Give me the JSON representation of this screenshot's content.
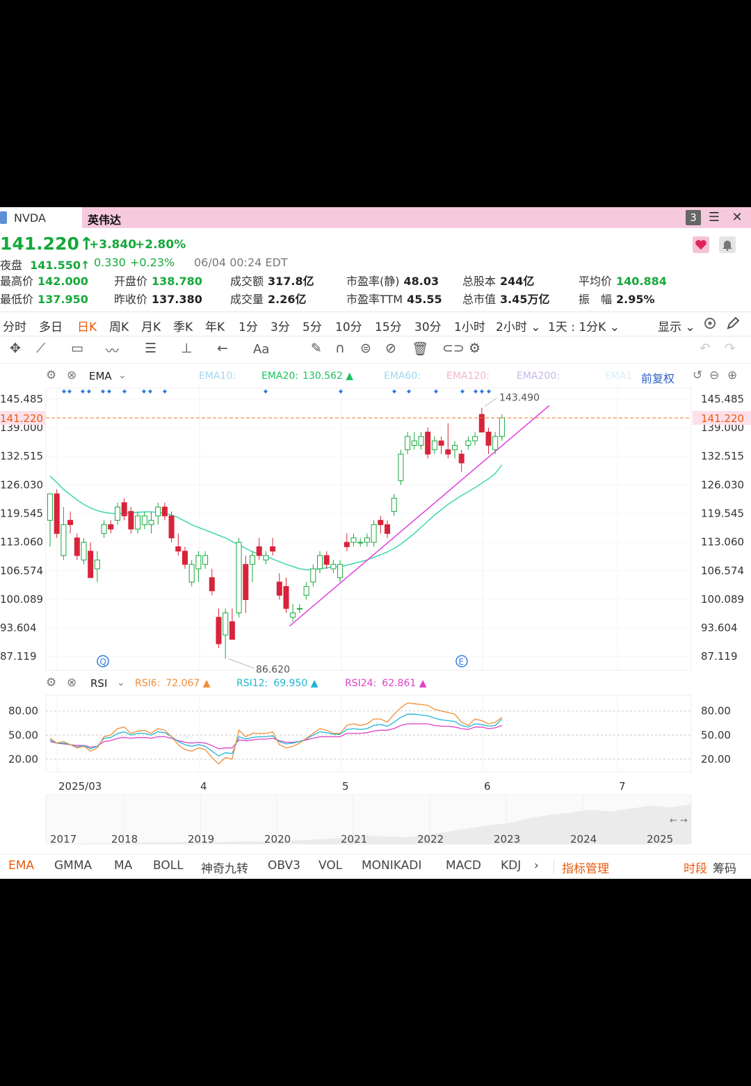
{
  "window": {
    "symbol": "NVDA",
    "name": "英伟达",
    "btn_layout": "3",
    "btn_menu": "☰",
    "btn_close": "✕"
  },
  "quote": {
    "price": "141.220",
    "arrow": "↑",
    "change": "+3.840",
    "change_pct": "+2.80%",
    "night_label": "夜盘",
    "night_price": "141.550↑",
    "night_change": "0.330",
    "night_pct": "+0.23%",
    "night_time": "06/04 00:24 EDT",
    "fields": [
      {
        "label": "最高价",
        "value": "142.000",
        "style": "g"
      },
      {
        "label": "开盘价",
        "value": "138.780",
        "style": "g"
      },
      {
        "label": "成交额",
        "value": "317.8亿",
        "style": "k"
      },
      {
        "label": "市盈率(静)",
        "value": "48.03",
        "style": "k"
      },
      {
        "label": "总股本",
        "value": "244亿",
        "style": "k"
      },
      {
        "label": "平均价",
        "value": "140.884",
        "style": "g"
      },
      {
        "label": "最低价",
        "value": "137.950",
        "style": "g"
      },
      {
        "label": "昨收价",
        "value": "137.380",
        "style": "k"
      },
      {
        "label": "成交量",
        "value": "2.26亿",
        "style": "k"
      },
      {
        "label": "市盈率TTM",
        "value": "45.55",
        "style": "k"
      },
      {
        "label": "总市值",
        "value": "3.45万亿",
        "style": "k"
      },
      {
        "label": "振　幅",
        "value": "2.95%",
        "style": "k"
      }
    ]
  },
  "periods": [
    "分时",
    "多日",
    "日K",
    "周K",
    "月K",
    "季K",
    "年K",
    "1分",
    "3分",
    "5分",
    "10分",
    "15分",
    "30分",
    "1小时",
    "2小时 ⌄",
    "1天 : 1分K ⌄",
    "显示 ⌄"
  ],
  "active_period": "日K",
  "toolbar_icons": [
    "move-icon",
    "line-tool-icon",
    "rect-tool-icon",
    "wave-tool-icon",
    "fib-tool-icon",
    "level-tool-icon",
    "arrow-tool-icon",
    "text-tool-icon",
    "comment-tool-icon",
    "pen-icon",
    "magnet-icon",
    "eye-icon",
    "hide-icon",
    "trash-icon",
    "link-icon",
    "settings-icon"
  ],
  "toolbar_text_label": "Aa",
  "main_indicator": {
    "name": "EMA",
    "items": [
      {
        "label": "EMA10:",
        "value": "",
        "color": "#9fd6ef"
      },
      {
        "label": "EMA20:",
        "value": "130.562 ▲",
        "color": "#19c25a"
      },
      {
        "label": "EMA60:",
        "value": "",
        "color": "#9fd6ef"
      },
      {
        "label": "EMA120:",
        "value": "",
        "color": "#f5b3c9"
      },
      {
        "label": "EMA200:",
        "value": "",
        "color": "#c9b6e8"
      },
      {
        "label": "EMA1",
        "value": "",
        "color": "#d6eef8"
      }
    ],
    "adjust": "前复权"
  },
  "sub_indicator": {
    "name": "RSI",
    "items": [
      {
        "label": "RSI6:",
        "value": "72.067 ▲",
        "color": "#f08c35"
      },
      {
        "label": "RSI12:",
        "value": "69.950 ▲",
        "color": "#1fb6d6"
      },
      {
        "label": "RSI24:",
        "value": "62.861 ▲",
        "color": "#e040c8"
      }
    ]
  },
  "y_ticks": [
    "145.485",
    "139.000",
    "132.515",
    "126.030",
    "119.545",
    "113.060",
    "106.574",
    "100.089",
    "93.604",
    "87.119"
  ],
  "current_price_tag": "141.220",
  "rsi_ticks": [
    "80.00",
    "50.00",
    "20.00"
  ],
  "high_label": "143.490",
  "low_label": "86.620",
  "x_labels": [
    "2025/03",
    "4",
    "5",
    "6",
    "7"
  ],
  "overview_years": [
    "2017",
    "2018",
    "2019",
    "2020",
    "2021",
    "2022",
    "2023",
    "2024",
    "2025"
  ],
  "marker_q": "Q",
  "marker_e": "E",
  "bottom_tabs": [
    "EMA",
    "GMMA",
    "MA",
    "BOLL",
    "神奇九转",
    "OBV3",
    "VOL",
    "MONIKADI",
    "MACD",
    "KDJ",
    "›",
    "指标管理"
  ],
  "bottom_right": [
    "时段",
    "筹码"
  ],
  "colors": {
    "up": "#15a83a",
    "down": "#d8233a",
    "accent": "#e8590c",
    "ema20": "#3dd6b0",
    "trend": "#e040e0"
  },
  "chart_data": {
    "type": "candlestick",
    "symbol": "NVDA",
    "ylim": [
      84,
      148
    ],
    "candles": [
      {
        "o": 118,
        "h": 124,
        "l": 112,
        "c": 124
      },
      {
        "o": 124,
        "h": 125,
        "l": 114,
        "c": 115
      },
      {
        "o": 110,
        "h": 121,
        "l": 109,
        "c": 117
      },
      {
        "o": 118,
        "h": 120,
        "l": 115,
        "c": 117
      },
      {
        "o": 114,
        "h": 115,
        "l": 109,
        "c": 110
      },
      {
        "o": 109,
        "h": 114,
        "l": 108,
        "c": 113
      },
      {
        "o": 111,
        "h": 113,
        "l": 105,
        "c": 105
      },
      {
        "o": 107,
        "h": 111,
        "l": 104,
        "c": 109
      },
      {
        "o": 115,
        "h": 118,
        "l": 114,
        "c": 117
      },
      {
        "o": 117,
        "h": 118,
        "l": 115,
        "c": 116
      },
      {
        "o": 118,
        "h": 122,
        "l": 117,
        "c": 121
      },
      {
        "o": 122,
        "h": 123,
        "l": 118,
        "c": 119
      },
      {
        "o": 120,
        "h": 121,
        "l": 115,
        "c": 116
      },
      {
        "o": 116,
        "h": 120,
        "l": 115,
        "c": 119
      },
      {
        "o": 117,
        "h": 120,
        "l": 116,
        "c": 119
      },
      {
        "o": 117,
        "h": 120,
        "l": 115,
        "c": 118
      },
      {
        "o": 119,
        "h": 122,
        "l": 117,
        "c": 121
      },
      {
        "o": 121,
        "h": 122,
        "l": 118,
        "c": 119
      },
      {
        "o": 119,
        "h": 120,
        "l": 113,
        "c": 114
      },
      {
        "o": 112,
        "h": 115,
        "l": 110,
        "c": 111
      },
      {
        "o": 111,
        "h": 112,
        "l": 107,
        "c": 108
      },
      {
        "o": 104,
        "h": 109,
        "l": 103,
        "c": 108
      },
      {
        "o": 107,
        "h": 111,
        "l": 104,
        "c": 110
      },
      {
        "o": 108,
        "h": 111,
        "l": 107,
        "c": 110
      },
      {
        "o": 105,
        "h": 107,
        "l": 101,
        "c": 102
      },
      {
        "o": 96,
        "h": 98,
        "l": 89,
        "c": 90
      },
      {
        "o": 92,
        "h": 98,
        "l": 86.62,
        "c": 97
      },
      {
        "o": 95,
        "h": 98,
        "l": 91,
        "c": 91
      },
      {
        "o": 97,
        "h": 114,
        "l": 96,
        "c": 113
      },
      {
        "o": 108,
        "h": 110,
        "l": 97,
        "c": 100
      },
      {
        "o": 108,
        "h": 111,
        "l": 104,
        "c": 110
      },
      {
        "o": 112,
        "h": 114,
        "l": 109,
        "c": 110
      },
      {
        "o": 109,
        "h": 111,
        "l": 108,
        "c": 110
      },
      {
        "o": 112,
        "h": 114,
        "l": 110,
        "c": 111
      },
      {
        "o": 104,
        "h": 106,
        "l": 100,
        "c": 101
      },
      {
        "o": 103,
        "h": 105,
        "l": 97,
        "c": 98
      },
      {
        "o": 96,
        "h": 99,
        "l": 95,
        "c": 97
      },
      {
        "o": 98,
        "h": 99,
        "l": 97,
        "c": 98
      },
      {
        "o": 101,
        "h": 104,
        "l": 100,
        "c": 103
      },
      {
        "o": 104,
        "h": 108,
        "l": 103,
        "c": 107
      },
      {
        "o": 107,
        "h": 111,
        "l": 106,
        "c": 110
      },
      {
        "o": 110,
        "h": 111,
        "l": 107,
        "c": 108
      },
      {
        "o": 107,
        "h": 109,
        "l": 106,
        "c": 108
      },
      {
        "o": 105,
        "h": 109,
        "l": 104,
        "c": 108
      },
      {
        "o": 113,
        "h": 115,
        "l": 111,
        "c": 112
      },
      {
        "o": 113,
        "h": 115,
        "l": 112,
        "c": 114
      },
      {
        "o": 113,
        "h": 114,
        "l": 112,
        "c": 113
      },
      {
        "o": 113,
        "h": 115,
        "l": 112,
        "c": 114
      },
      {
        "o": 113,
        "h": 118,
        "l": 112,
        "c": 117
      },
      {
        "o": 118,
        "h": 119,
        "l": 115,
        "c": 117
      },
      {
        "o": 117,
        "h": 118,
        "l": 114,
        "c": 115
      },
      {
        "o": 120,
        "h": 124,
        "l": 119,
        "c": 123
      },
      {
        "o": 127,
        "h": 134,
        "l": 126,
        "c": 133
      },
      {
        "o": 134,
        "h": 138,
        "l": 133,
        "c": 137
      },
      {
        "o": 135,
        "h": 138,
        "l": 134,
        "c": 136
      },
      {
        "o": 135,
        "h": 138,
        "l": 134,
        "c": 137
      },
      {
        "o": 138,
        "h": 139,
        "l": 132,
        "c": 133
      },
      {
        "o": 134,
        "h": 137,
        "l": 133,
        "c": 136
      },
      {
        "o": 136,
        "h": 137,
        "l": 133,
        "c": 135
      },
      {
        "o": 134,
        "h": 140,
        "l": 132,
        "c": 133
      },
      {
        "o": 134,
        "h": 136,
        "l": 132,
        "c": 135
      },
      {
        "o": 133,
        "h": 134,
        "l": 129,
        "c": 131
      },
      {
        "o": 135,
        "h": 137,
        "l": 134,
        "c": 136
      },
      {
        "o": 136,
        "h": 138,
        "l": 135,
        "c": 137
      },
      {
        "o": 142,
        "h": 143.49,
        "l": 138,
        "c": 138
      },
      {
        "o": 138,
        "h": 139,
        "l": 133,
        "c": 135
      },
      {
        "o": 134,
        "h": 138,
        "l": 133,
        "c": 137
      },
      {
        "o": 137,
        "h": 142,
        "l": 136,
        "c": 141.22
      }
    ],
    "ema20": [
      128,
      126.6,
      125,
      123.8,
      122.6,
      121.6,
      120.8,
      120.2,
      119.8,
      119.6,
      119.5,
      119.6,
      119.7,
      119.8,
      119.9,
      119.9,
      119.8,
      119.6,
      119.2,
      118.6,
      117.8,
      117,
      116.4,
      115.8,
      115.2,
      114.6,
      114,
      113.2,
      112.4,
      111.6,
      110.9,
      110.3,
      109.8,
      109.2,
      108.6,
      108,
      107.5,
      107,
      106.8,
      106.8,
      107,
      107.2,
      107.4,
      107.5,
      107.8,
      108.2,
      108.6,
      109,
      109.6,
      110.2,
      110.8,
      111.6,
      112.6,
      113.8,
      115,
      116.4,
      117.8,
      119.2,
      120.4,
      121.6,
      122.6,
      123.6,
      124.5,
      125.4,
      126.4,
      127.4,
      128.6,
      130.562
    ],
    "trendline": [
      {
        "i": 35.5,
        "v": 94
      },
      {
        "i": 74,
        "v": 144
      }
    ],
    "rsi": {
      "ylim": [
        0,
        100
      ],
      "gridlines": [
        80,
        50,
        20
      ],
      "rsi6": [
        46,
        40,
        42,
        38,
        34,
        36,
        30,
        34,
        48,
        50,
        58,
        60,
        52,
        55,
        56,
        52,
        58,
        56,
        48,
        38,
        32,
        30,
        34,
        32,
        22,
        14,
        22,
        20,
        56,
        48,
        52,
        52,
        52,
        54,
        38,
        34,
        36,
        40,
        46,
        52,
        58,
        56,
        52,
        52,
        62,
        64,
        62,
        64,
        70,
        70,
        66,
        76,
        84,
        90,
        89,
        88,
        87,
        82,
        80,
        78,
        76,
        66,
        62,
        70,
        68,
        64,
        66,
        72
      ],
      "rsi12": [
        44,
        40,
        40,
        38,
        35,
        37,
        33,
        36,
        46,
        47,
        52,
        54,
        50,
        52,
        52,
        50,
        54,
        53,
        48,
        42,
        38,
        36,
        38,
        36,
        30,
        24,
        28,
        27,
        48,
        45,
        47,
        48,
        48,
        49,
        42,
        39,
        40,
        42,
        45,
        50,
        54,
        53,
        51,
        51,
        57,
        58,
        57,
        58,
        62,
        63,
        61,
        66,
        72,
        76,
        76,
        75,
        74,
        71,
        69,
        68,
        67,
        62,
        60,
        64,
        63,
        61,
        62,
        70
      ],
      "rsi24": [
        42,
        40,
        39,
        38,
        37,
        37,
        35,
        36,
        42,
        43,
        46,
        47,
        46,
        47,
        47,
        46,
        48,
        48,
        46,
        43,
        41,
        40,
        41,
        40,
        37,
        33,
        34,
        34,
        44,
        43,
        44,
        45,
        45,
        46,
        43,
        41,
        41,
        42,
        44,
        46,
        48,
        48,
        48,
        48,
        52,
        52,
        52,
        53,
        55,
        56,
        56,
        58,
        62,
        64,
        64,
        64,
        64,
        62,
        61,
        61,
        60,
        58,
        57,
        60,
        60,
        58,
        59,
        62
      ]
    },
    "overview_area": [
      0.05,
      0.04,
      0.05,
      0.06,
      0.05,
      0.08,
      0.1,
      0.12,
      0.15,
      0.2,
      0.18,
      0.16,
      0.22,
      0.3,
      0.38,
      0.45,
      0.5,
      0.62,
      0.7,
      0.75,
      0.82,
      0.78,
      0.85,
      0.92,
      0.88,
      0.95
    ]
  }
}
